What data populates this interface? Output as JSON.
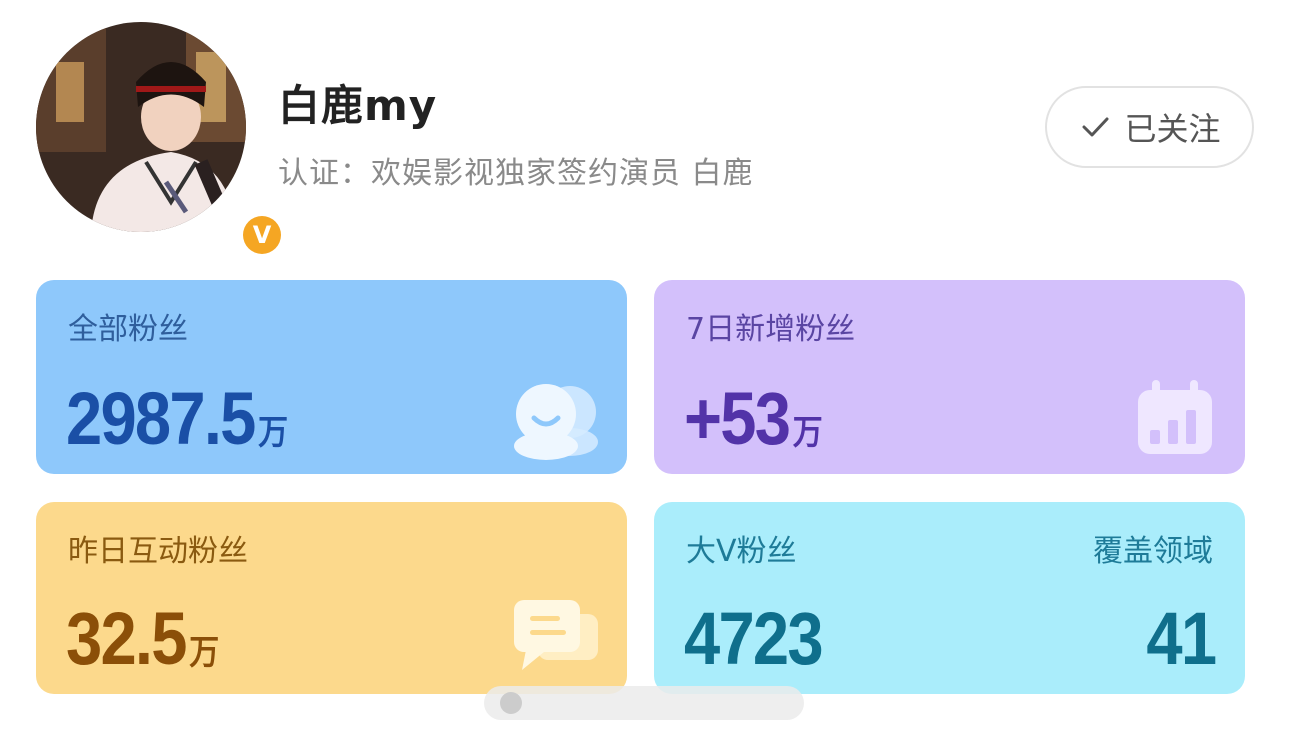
{
  "profile": {
    "name": "白鹿my",
    "verification": "认证：欢娱影视独家签约演员 白鹿",
    "badge_letter": "V",
    "follow_label": "已关注"
  },
  "cards": {
    "total_fans": {
      "label": "全部粉丝",
      "value": "2987.5",
      "unit": "万",
      "icon": "people-icon",
      "color": "#8ec8fb"
    },
    "new_fans_7d": {
      "label": "7日新增粉丝",
      "value": "+53",
      "unit": "万",
      "icon": "calendar-chart-icon",
      "color": "#d3c0fb"
    },
    "interactive_fans": {
      "label": "昨日互动粉丝",
      "value": "32.5",
      "unit": "万",
      "icon": "chat-bubble-icon",
      "color": "#fcd98c"
    },
    "big_v_fans": {
      "label": "大V粉丝",
      "value": "4723",
      "coverage_label": "覆盖领域",
      "coverage_value": "41",
      "color": "#aaedfb"
    }
  }
}
